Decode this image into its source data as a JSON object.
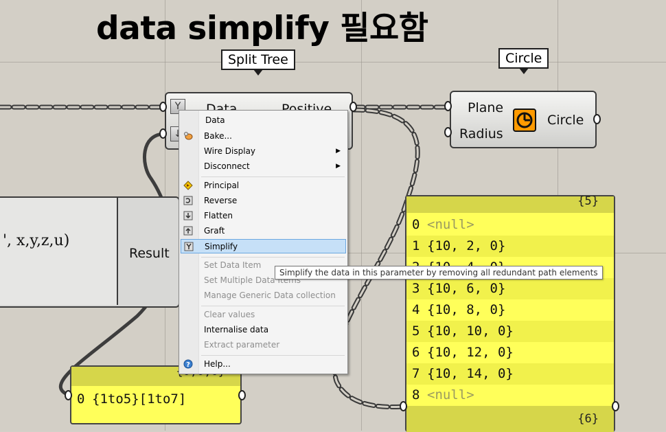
{
  "headline": "data simplify 필요함",
  "split_tree": {
    "balloon": "Split Tree",
    "input_data": "Data",
    "output_positive": "Positive"
  },
  "circle": {
    "balloon": "Circle",
    "input_plane": "Plane",
    "input_radius": "Radius",
    "output": "Circle"
  },
  "expression": {
    "text": "', x,y,z,u)",
    "output": "Result"
  },
  "panel_left": {
    "path": "{0;0;0}",
    "rows": [
      {
        "index": "0",
        "value": "{1to5}[1to7]"
      }
    ]
  },
  "panel_right": {
    "path_top": "{5}",
    "path_bottom": "{6}",
    "rows": [
      {
        "index": "0",
        "value": "<null>",
        "null": true
      },
      {
        "index": "1",
        "value": "{10, 2, 0}"
      },
      {
        "index": "2",
        "value": "{10, 4, 0}"
      },
      {
        "index": "3",
        "value": "{10, 6, 0}"
      },
      {
        "index": "4",
        "value": "{10, 8, 0}"
      },
      {
        "index": "5",
        "value": "{10, 10, 0}"
      },
      {
        "index": "6",
        "value": "{10, 12, 0}"
      },
      {
        "index": "7",
        "value": "{10, 14, 0}"
      },
      {
        "index": "8",
        "value": "<null>",
        "null": true
      }
    ]
  },
  "context_menu": {
    "header": "Data",
    "items": [
      {
        "label": "Bake...",
        "icon": "bake-icon",
        "disabled": false,
        "submenu": false
      },
      {
        "label": "Wire Display",
        "icon": "",
        "disabled": false,
        "submenu": true
      },
      {
        "label": "Disconnect",
        "icon": "",
        "disabled": false,
        "submenu": true
      },
      {
        "label": "Principal",
        "icon": "principal-icon",
        "disabled": false,
        "submenu": false
      },
      {
        "label": "Reverse",
        "icon": "reverse-icon",
        "disabled": false,
        "submenu": false
      },
      {
        "label": "Flatten",
        "icon": "flatten-icon",
        "disabled": false,
        "submenu": false
      },
      {
        "label": "Graft",
        "icon": "graft-icon",
        "disabled": false,
        "submenu": false
      },
      {
        "label": "Simplify",
        "icon": "simplify-icon",
        "disabled": false,
        "submenu": false,
        "selected": true
      },
      {
        "label": "Set Data Item",
        "icon": "",
        "disabled": true,
        "submenu": true
      },
      {
        "label": "Set Multiple Data Items",
        "icon": "",
        "disabled": true,
        "submenu": false
      },
      {
        "label": "Manage Generic Data collection",
        "icon": "",
        "disabled": true,
        "submenu": false
      },
      {
        "label": "Clear values",
        "icon": "",
        "disabled": true,
        "submenu": false
      },
      {
        "label": "Internalise data",
        "icon": "",
        "disabled": false,
        "submenu": false
      },
      {
        "label": "Extract parameter",
        "icon": "",
        "disabled": true,
        "submenu": false
      },
      {
        "label": "Help...",
        "icon": "help-icon",
        "disabled": false,
        "submenu": false
      }
    ]
  },
  "tooltip": "Simplify the data in this parameter by removing all redundant path elements",
  "colors": {
    "panel_yellow": "#ffff5a",
    "menu_highlight": "#c6e0f7",
    "canvas": "#d3cfc6"
  }
}
